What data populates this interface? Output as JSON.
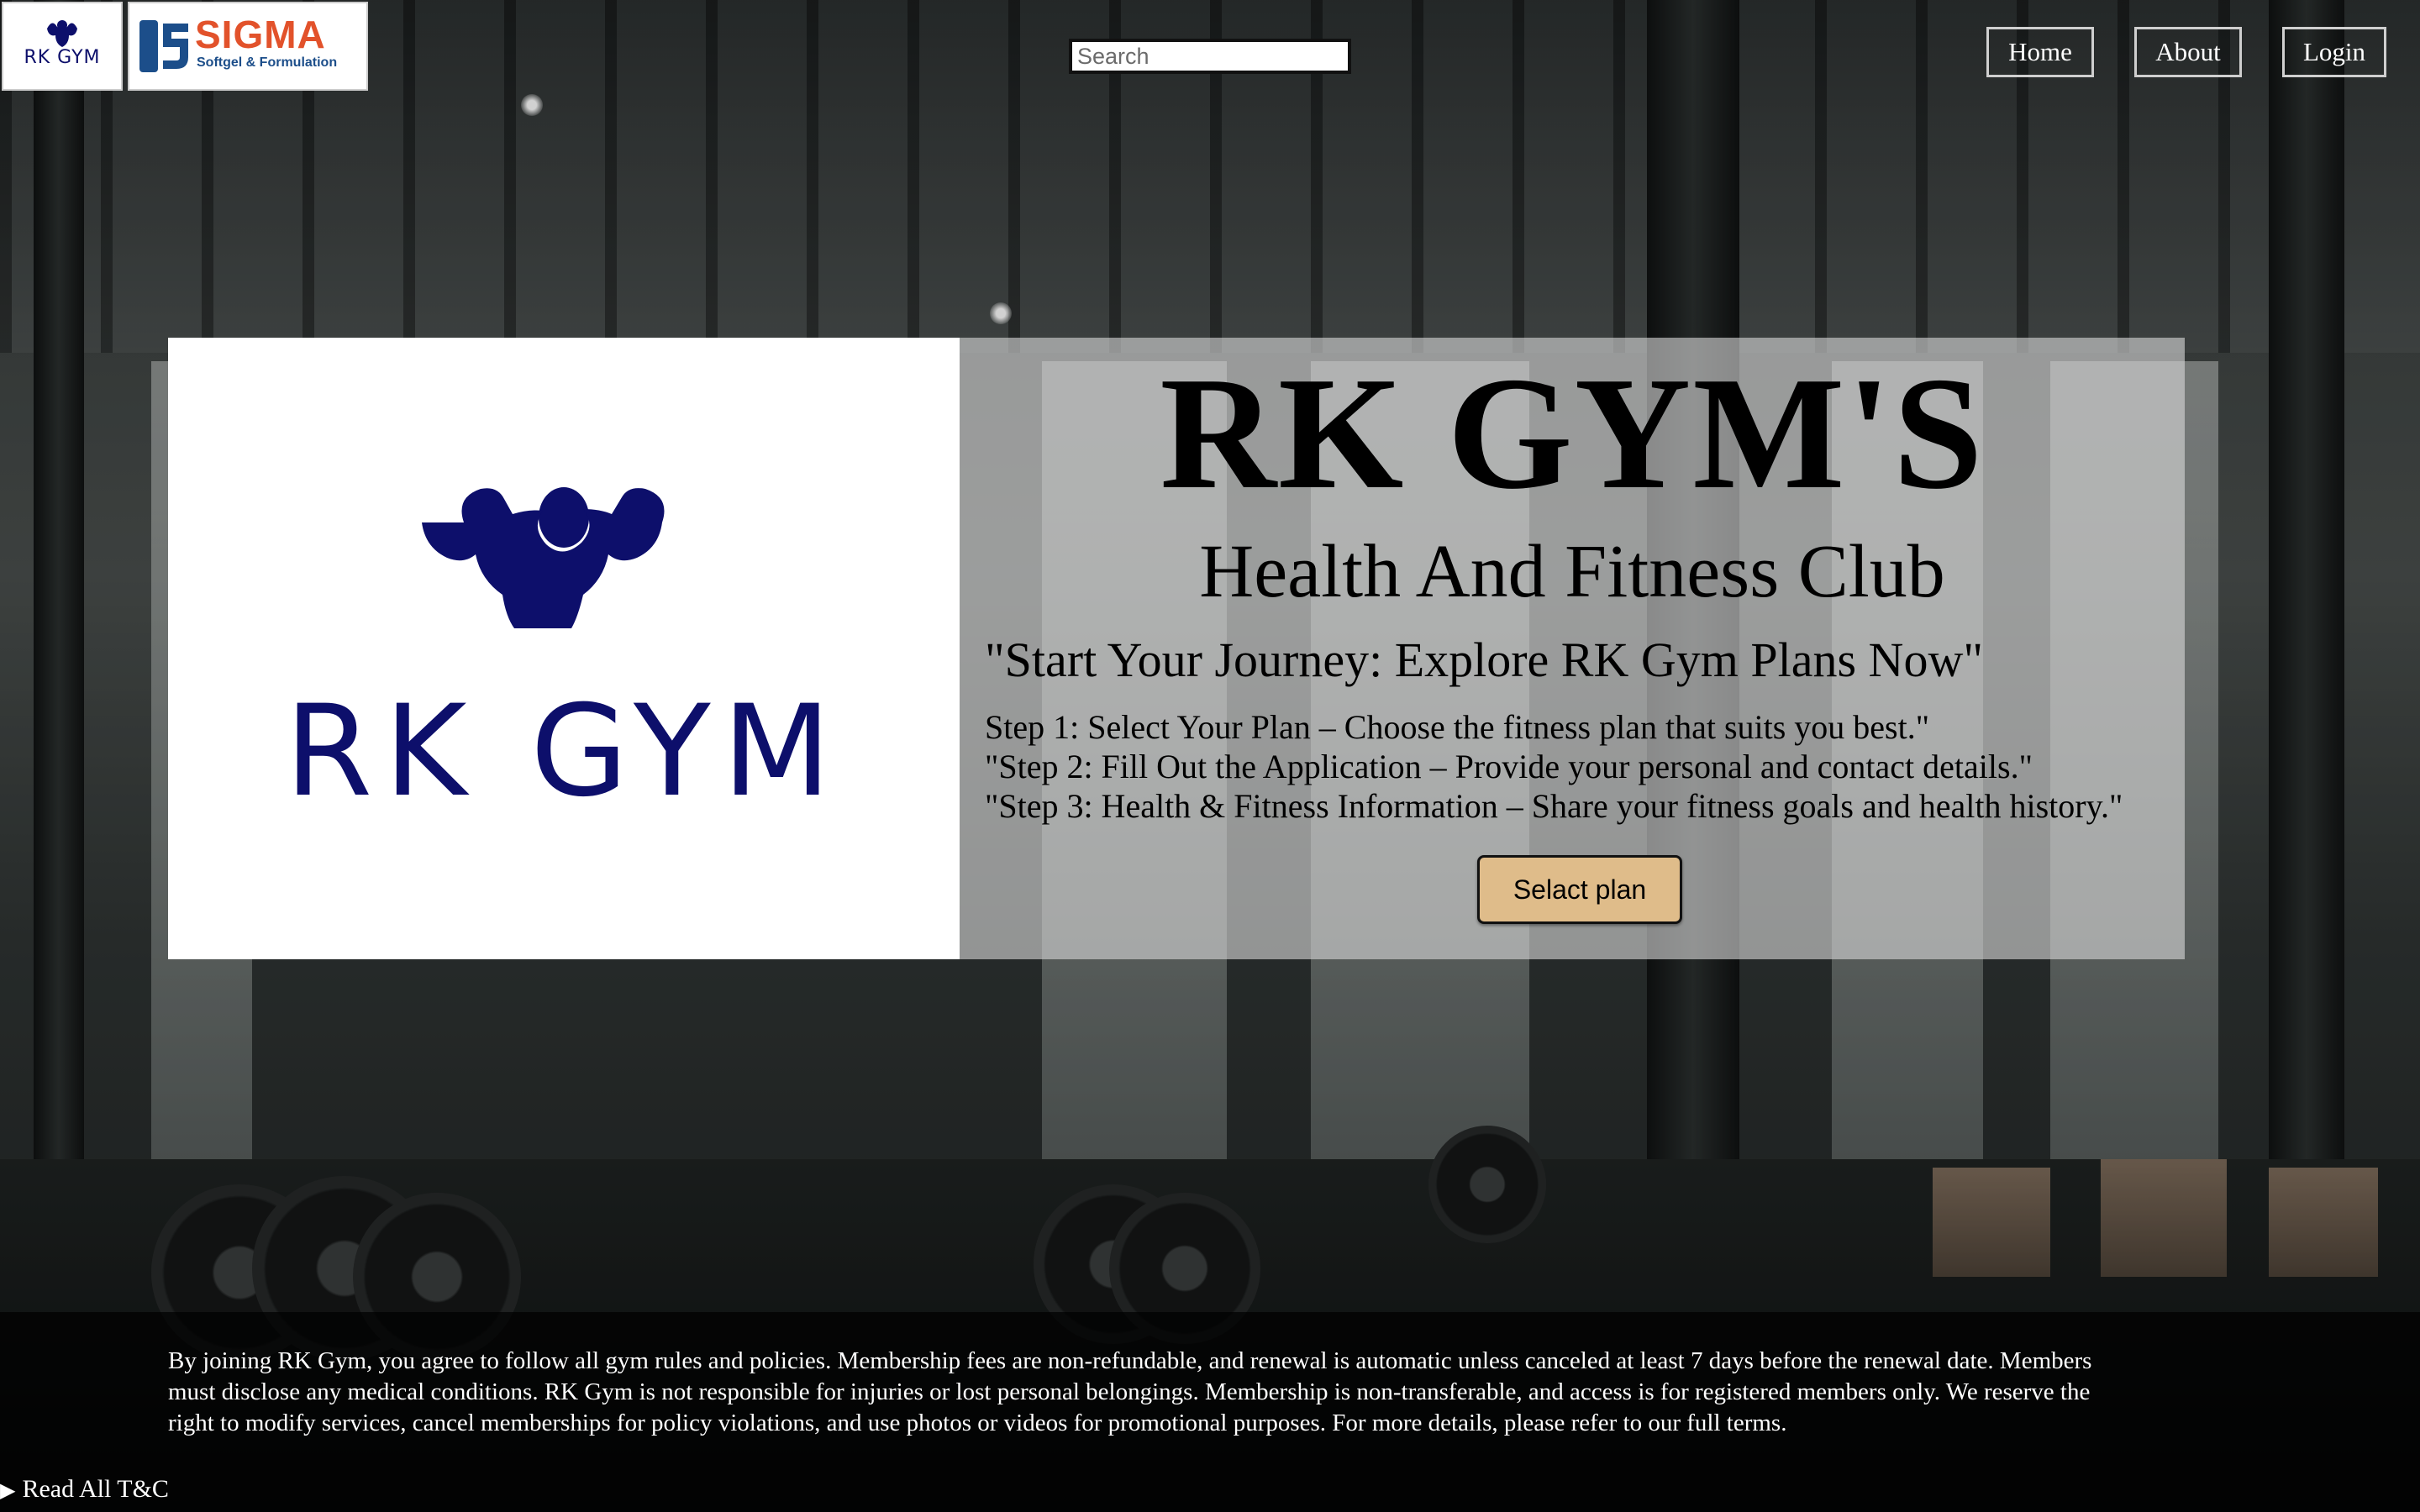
{
  "header": {
    "logo_small_text": "RK GYM",
    "sponsor_name": "SIGMA",
    "sponsor_tagline": "Softgel & Formulation",
    "search_placeholder": "Search",
    "nav": {
      "home": "Home",
      "about": "About",
      "login": "Login"
    }
  },
  "hero": {
    "logo_text": "RK GYM",
    "title": "RK GYM'S",
    "subtitle": "Health And Fitness Club",
    "tagline": "\"Start Your Journey: Explore RK Gym Plans Now\"",
    "steps": [
      "Step 1: Select Your Plan – Choose the fitness plan that suits you best.\"",
      "\"Step 2: Fill Out the Application – Provide your personal and contact details.\"",
      "\"Step 3: Health & Fitness Information – Share your fitness goals and health history.\""
    ],
    "select_button": "Selact plan"
  },
  "terms": {
    "text": "By joining RK Gym, you agree to follow all gym rules and policies. Membership fees are non-refundable, and renewal is automatic unless canceled at least 7 days before the renewal date. Members must disclose any medical conditions. RK Gym is not responsible for injuries or lost personal belongings. Membership is non-transferable, and access is for registered members only. We reserve the right to modify services, cancel memberships for policy violations, and use photos or videos for promotional purposes. For more details, please refer to our full terms.",
    "toggle_label": "Read All T&C"
  },
  "colors": {
    "brand_navy": "#0d0f6b",
    "sigma_blue": "#1c4e8a",
    "sigma_orange": "#e2522b",
    "button_tan": "#dfbc8a"
  },
  "icons": {
    "logo_figure": "muscle-man-icon",
    "sigma_mark": "sigma-logo-mark",
    "toggle": "disclosure-triangle-icon"
  }
}
